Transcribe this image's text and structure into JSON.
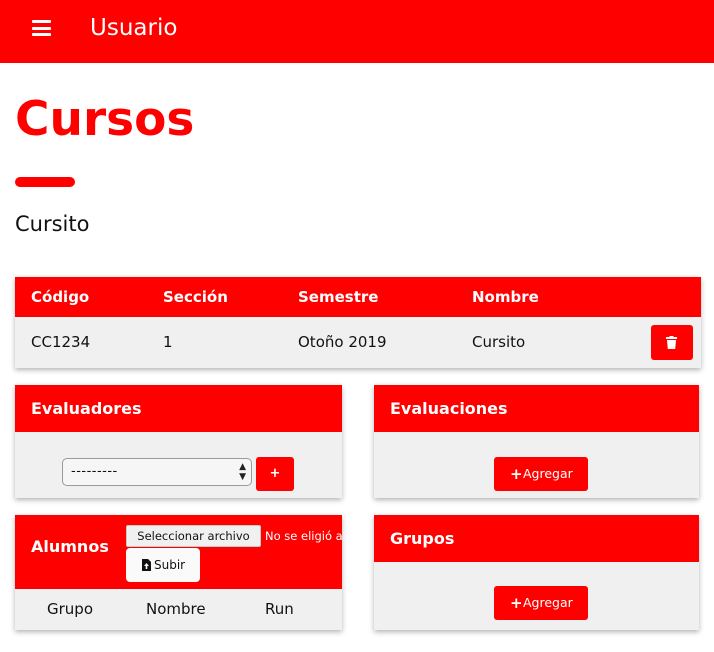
{
  "header": {
    "brand": "Usuario",
    "menu_icon": "hamburger-menu-icon"
  },
  "page": {
    "title": "Cursos",
    "course_name": "Cursito"
  },
  "course_table": {
    "columns": [
      "Código",
      "Sección",
      "Semestre",
      "Nombre"
    ],
    "row": [
      "CC1234",
      "1",
      "Otoño 2019",
      "Cursito"
    ],
    "delete_icon": "trash-icon"
  },
  "evaluadores": {
    "title": "Evaluadores",
    "select_value": "---------",
    "add_label": "+"
  },
  "evaluaciones": {
    "title": "Evaluaciones",
    "add_label": "Agregar",
    "plus": "+"
  },
  "alumnos": {
    "title": "Alumnos",
    "file_button": "Seleccionar archivo",
    "file_status": "No se eligió archivo",
    "upload_label": "Subir",
    "upload_icon": "file-upload-icon",
    "columns": [
      "Grupo",
      "Nombre",
      "Run"
    ]
  },
  "grupos": {
    "title": "Grupos",
    "add_label": "Agregar",
    "plus": "+"
  },
  "colors": {
    "accent": "#ff0000",
    "panel_bg": "#f0f0f0",
    "text": "#111111"
  }
}
